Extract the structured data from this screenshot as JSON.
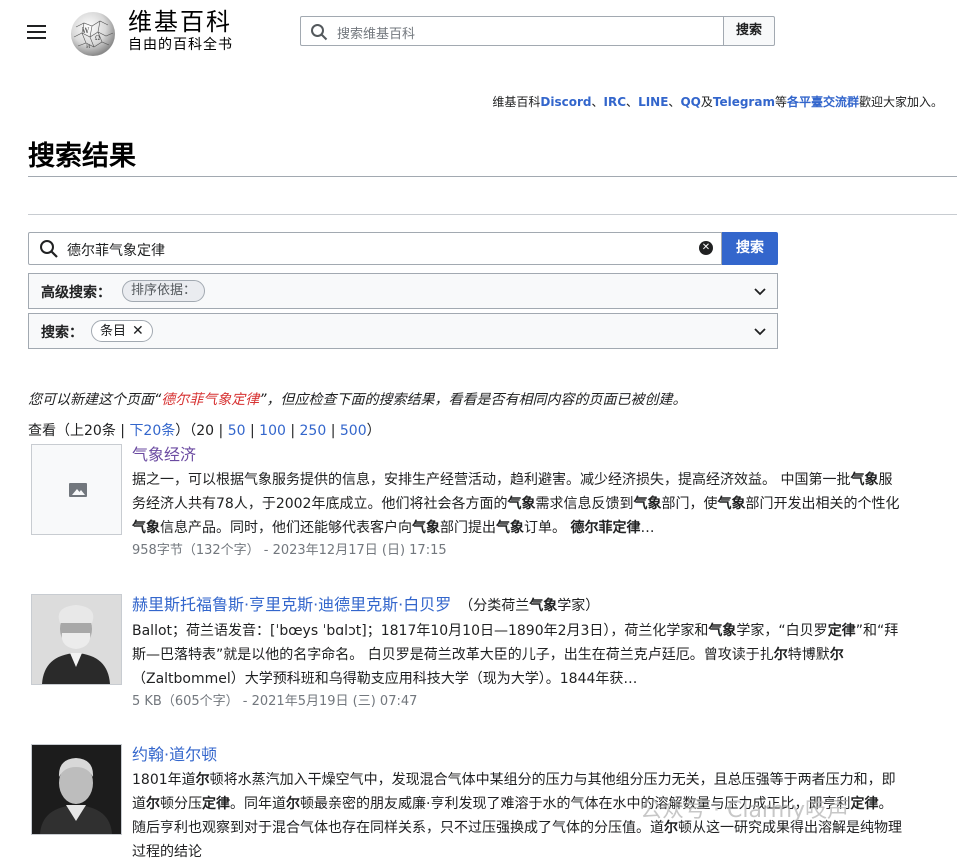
{
  "header": {
    "wordmark": "维基百科",
    "tagline": "自由的百科全书",
    "search_placeholder": "搜索维基百科",
    "search_button": "搜索"
  },
  "sitenotice": {
    "prefix": "维基百科",
    "discord": "Discord",
    "sep1": "、",
    "irc": "IRC",
    "sep2": "、",
    "line": "LINE",
    "sep3": "、",
    "qq": "QQ",
    "and": "及",
    "telegram": "Telegram",
    "mid": "等",
    "groups": "各平臺交流群",
    "suffix": "歡迎大家加入。"
  },
  "page_title": "搜索结果",
  "search": {
    "value": "德尔菲气象定律",
    "button": "搜索",
    "advanced_label": "高级搜索：",
    "sort_chip": "排序依据：",
    "namespace_label": "搜索：",
    "namespace_chip": "条目"
  },
  "create_note": {
    "before": "您可以新建这个页面“",
    "link": "德尔菲气象定律",
    "after": "”，但应检查下面的搜索结果，看看是否有相同内容的页面已被创建。"
  },
  "viewing": {
    "prefix": "查看（上20条 | ",
    "next": "下20条",
    "mid": "）（20 | ",
    "n50": "50",
    "sep1": " | ",
    "n100": "100",
    "sep2": " | ",
    "n250": "250",
    "sep3": " | ",
    "n500": "500",
    "end": "）"
  },
  "results": [
    {
      "title": "气象经济",
      "category": "",
      "snippet": [
        [
          "据之一，可以根据气象服务提供的信息，安排生产经营活动，趋利避害。减少经济损失，提高经济效益。 中国第一批",
          false
        ],
        [
          "气象",
          true
        ],
        [
          "服务经济人共有78人，于2002年底成立。他们将社会各方面的",
          false
        ],
        [
          "气象",
          true
        ],
        [
          "需求信息反馈到",
          false
        ],
        [
          "气象",
          true
        ],
        [
          "部门，使",
          false
        ],
        [
          "气象",
          true
        ],
        [
          "部门开发出相关的个性化",
          false
        ],
        [
          "气象",
          true
        ],
        [
          "信息产品。同时，他们还能够代表客户向",
          false
        ],
        [
          "气象",
          true
        ],
        [
          "部门提出",
          false
        ],
        [
          "气象",
          true
        ],
        [
          "订单。 ",
          false
        ],
        [
          "德尔菲定律",
          true
        ],
        [
          "…",
          false
        ]
      ],
      "meta": "958字节（132个字） - 2023年12月17日 (日) 17:15"
    },
    {
      "title": "赫里斯托福鲁斯·亨里克斯·迪德里克斯·白贝罗",
      "category_prefix": "（分类荷兰",
      "category_bold": "气象",
      "category_suffix": "学家）",
      "snippet": [
        [
          "Ballot；荷兰语发音：[ˈbœys ˈbɑlɔt]；1817年10月10日—1890年2月3日），荷兰化学家和",
          false
        ],
        [
          "气象",
          true
        ],
        [
          "学家，“白贝罗",
          false
        ],
        [
          "定律",
          true
        ],
        [
          "”和“拜斯—巴落特表”就是以他的名字命名。 白贝罗是荷兰改革大臣的儿子，出生在荷兰克卢廷厄。曾攻读于扎",
          false
        ],
        [
          "尔",
          true
        ],
        [
          "特博默",
          false
        ],
        [
          "尔",
          true
        ],
        [
          "（Zaltbommel）大学预科班和乌得勒支应用科技大学（现为大学）。1844年获…",
          false
        ]
      ],
      "meta": "5 KB（605个字） - 2021年5月19日 (三) 07:47"
    },
    {
      "title": "约翰·道尔顿",
      "category": "",
      "snippet": [
        [
          "1801年道",
          false
        ],
        [
          "尔",
          true
        ],
        [
          "顿将水蒸汽加入干燥空气中，发现混合气体中某组分的压力与其他组分压力无关，且总压强等于两者压力和，即道",
          false
        ],
        [
          "尔",
          true
        ],
        [
          "顿分压",
          false
        ],
        [
          "定律",
          true
        ],
        [
          "。同年道",
          false
        ],
        [
          "尔",
          true
        ],
        [
          "顿最亲密的朋友威廉·亨利发现了难溶于水的气体在水中的溶解数量与压力成正比，即亨利",
          false
        ],
        [
          "定律",
          true
        ],
        [
          "。随后亨利也观察到对于混合气体也存在同样关系，只不过压强换成了气体的分压值。道",
          false
        ],
        [
          "尔",
          true
        ],
        [
          "顿从这一研究成果得出溶解是纯物理过程的结论",
          false
        ]
      ],
      "meta": ""
    }
  ],
  "watermark": "公众号 · Clarmy吱声"
}
